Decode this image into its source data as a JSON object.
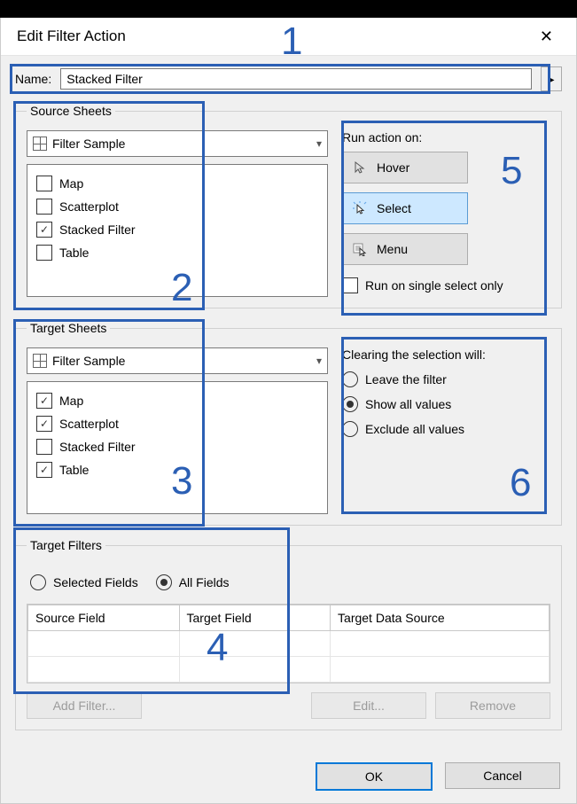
{
  "titlebar": {
    "title": "Edit Filter Action",
    "close_glyph": "✕"
  },
  "name_row": {
    "label": "Name:",
    "value": "Stacked Filter",
    "arrow_glyph": "▸"
  },
  "source": {
    "legend": "Source Sheets",
    "workbook": "Filter Sample",
    "sheets": [
      {
        "label": "Map",
        "checked": false
      },
      {
        "label": "Scatterplot",
        "checked": false
      },
      {
        "label": "Stacked Filter",
        "checked": true
      },
      {
        "label": "Table",
        "checked": false
      }
    ]
  },
  "run_action": {
    "legend": "Run action on:",
    "buttons": [
      {
        "label": "Hover",
        "selected": false,
        "icon": "hover"
      },
      {
        "label": "Select",
        "selected": true,
        "icon": "select"
      },
      {
        "label": "Menu",
        "selected": false,
        "icon": "menu"
      }
    ],
    "single_select": {
      "label": "Run on single select only",
      "checked": false
    }
  },
  "target": {
    "legend": "Target Sheets",
    "workbook": "Filter Sample",
    "sheets": [
      {
        "label": "Map",
        "checked": true
      },
      {
        "label": "Scatterplot",
        "checked": true
      },
      {
        "label": "Stacked Filter",
        "checked": false
      },
      {
        "label": "Table",
        "checked": true
      }
    ]
  },
  "clearing": {
    "legend": "Clearing the selection will:",
    "options": [
      {
        "label": "Leave the filter",
        "selected": false
      },
      {
        "label": "Show all values",
        "selected": true
      },
      {
        "label": "Exclude all values",
        "selected": false
      }
    ]
  },
  "target_filters": {
    "legend": "Target Filters",
    "mode": {
      "selected_fields": "Selected Fields",
      "all_fields": "All Fields",
      "value": "all"
    },
    "columns": {
      "source": "Source Field",
      "target": "Target Field",
      "ds": "Target Data Source"
    }
  },
  "grid_btns": {
    "add": "Add Filter...",
    "edit": "Edit...",
    "remove": "Remove"
  },
  "dlg_btns": {
    "ok": "OK",
    "cancel": "Cancel"
  },
  "annotations": [
    "1",
    "2",
    "3",
    "4",
    "5",
    "6"
  ]
}
